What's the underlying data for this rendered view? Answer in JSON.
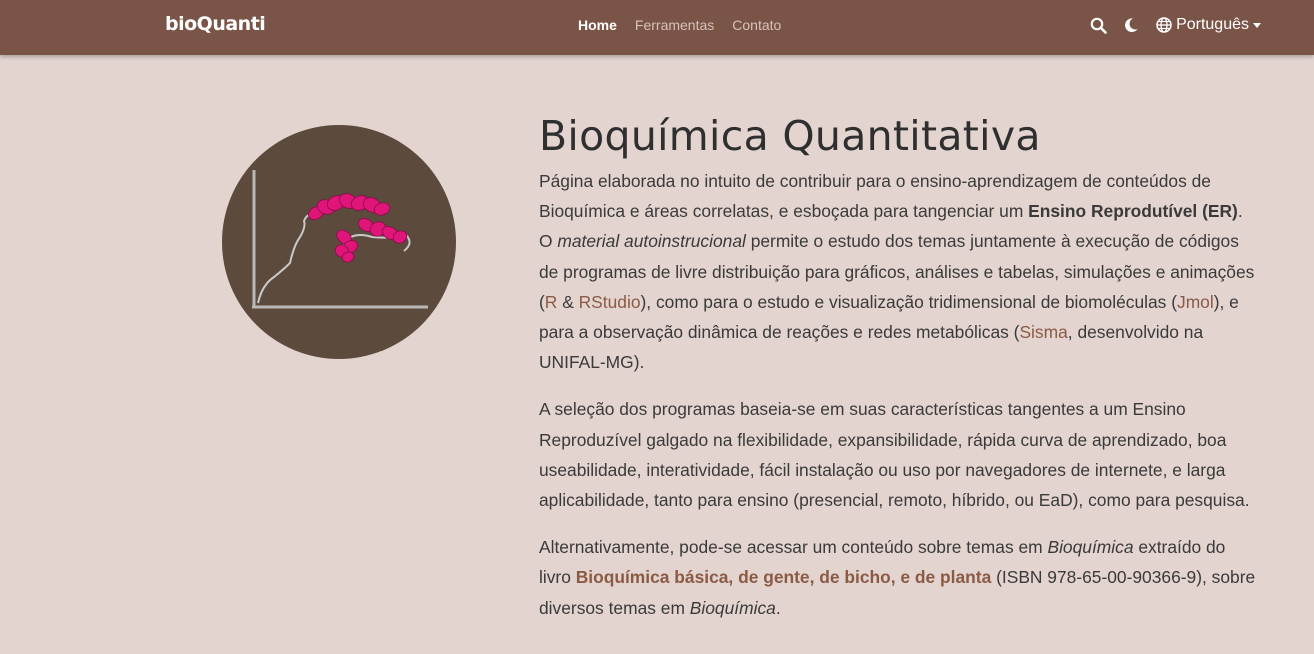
{
  "nav": {
    "brand": "bioQuanti",
    "links": [
      {
        "label": "Home",
        "active": true
      },
      {
        "label": "Ferramentas",
        "active": false
      },
      {
        "label": "Contato",
        "active": false
      }
    ],
    "search_icon": "search-icon",
    "theme_icon": "moon-icon",
    "language_icon": "globe-icon",
    "language": "Português"
  },
  "hero": {
    "logo_icon": "protein-helix-plot-icon",
    "title": "Bioquímica Quantitativa"
  },
  "p1": {
    "t1": "Página elaborada no intuito de contribuir para o ensino-aprendizagem de conteúdos de Bioquímica e áreas correlatas, e esboçada para tangenciar um ",
    "b1": "Ensino Reprodutível (ER)",
    "t2": ". O ",
    "i1": "material autoinstrucional",
    "t3": " permite o estudo dos temas juntamente à execução de códigos de programas de livre distribuição para gráficos, análises e tabelas, simulações e animações (",
    "l_r": "R",
    "t4": " & ",
    "l_rstudio": "RStudio",
    "t5": "), como para o estudo e visualização tridimensional de biomoléculas (",
    "l_jmol": "Jmol",
    "t6": "), e para a observação dinâmica de reações e redes metabólicas (",
    "l_sisma": "Sisma",
    "t7": ", desenvolvido na UNIFAL-MG)."
  },
  "p2": {
    "text": "A seleção dos programas baseia-se em suas características tangentes a um Ensino Reproduzível galgado na flexibilidade, expansibilidade, rápida curva de aprendizado, boa useabilidade, interatividade, fácil instalação ou uso por navegadores de internete, e larga aplicabilidade, tanto para ensino (presencial, remoto, híbrido, ou EaD), como para pesquisa."
  },
  "p3": {
    "t1": "Alternativamente, pode-se acessar um conteúdo sobre temas em ",
    "i1": "Bioquímica",
    "t2": " extraído do livro ",
    "l_book": "Bioquímica básica, de gente, de bicho, e de planta",
    "t3": " (ISBN 978-65-00-90366-9), sobre diversos temas em ",
    "i2": "Bioquímica",
    "t4": "."
  },
  "colors": {
    "navbar": "#7a5447",
    "background": "#e3d4d0",
    "link": "#8b5a45",
    "logo_bg": "#5c4a3d",
    "helix": "#e0157a"
  }
}
